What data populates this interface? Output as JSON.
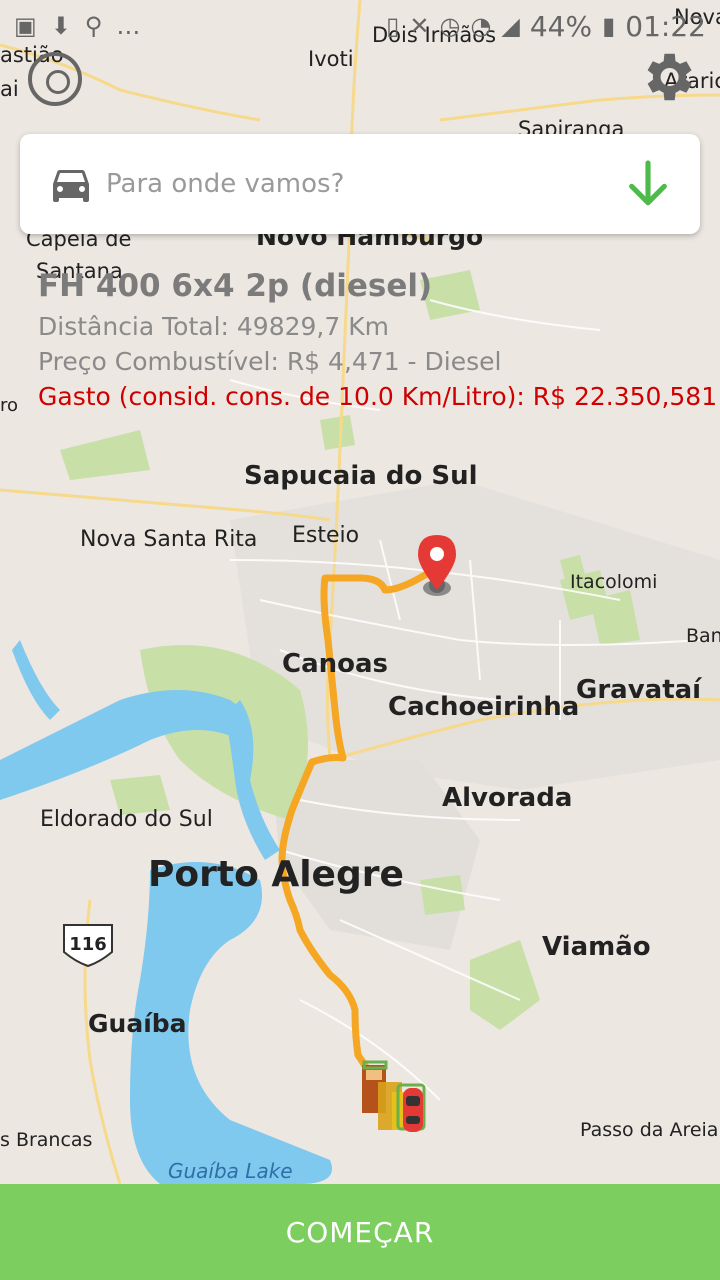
{
  "status_bar": {
    "battery": "44%",
    "time": "01:22"
  },
  "search": {
    "placeholder": "Para onde vamos?"
  },
  "vehicle": {
    "name": "FH 400 6x4 2p (diesel)",
    "distance": "Distância Total: 49829,7 Km",
    "fuel_price": "Preço Combustível: R$ 4,471 - Diesel",
    "cost": "Gasto (consid. cons. de 10.0 Km/Litro): R$ 22.350,581"
  },
  "map": {
    "labels": {
      "ivoti": "Ivoti",
      "dois_irmaos": "Dois Irmãos",
      "sapiranga": "Sapiranga",
      "novo_hamburgo": "Novo Hamburgo",
      "capela": "Capela de",
      "santana": "Santana",
      "bastiao": "astião",
      "ai": "ai",
      "nova_top": "Nova",
      "arari": "Araric",
      "ro": "ro",
      "sapucaia": "Sapucaia do Sul",
      "nova_santa_rita": "Nova Santa Rita",
      "esteio": "Esteio",
      "itacolomi": "Itacolomi",
      "ban": "Ban",
      "canoas": "Canoas",
      "cachoeirinha": "Cachoeirinha",
      "gravatai": "Gravataí",
      "alvorada": "Alvorada",
      "eldorado": "Eldorado do Sul",
      "porto_alegre": "Porto Alegre",
      "route_116": "116",
      "viamao": "Viamão",
      "guaiba": "Guaíba",
      "brancas": "s Brancas",
      "passo_areia": "Passo da Areia",
      "guaiba_lake": "Guaíba Lake"
    },
    "colors": {
      "route": "#f5a623",
      "water": "#7fc8ee",
      "park": "#c8dfa8",
      "marker": "#e53935"
    }
  },
  "actions": {
    "start": "COMEÇAR"
  }
}
